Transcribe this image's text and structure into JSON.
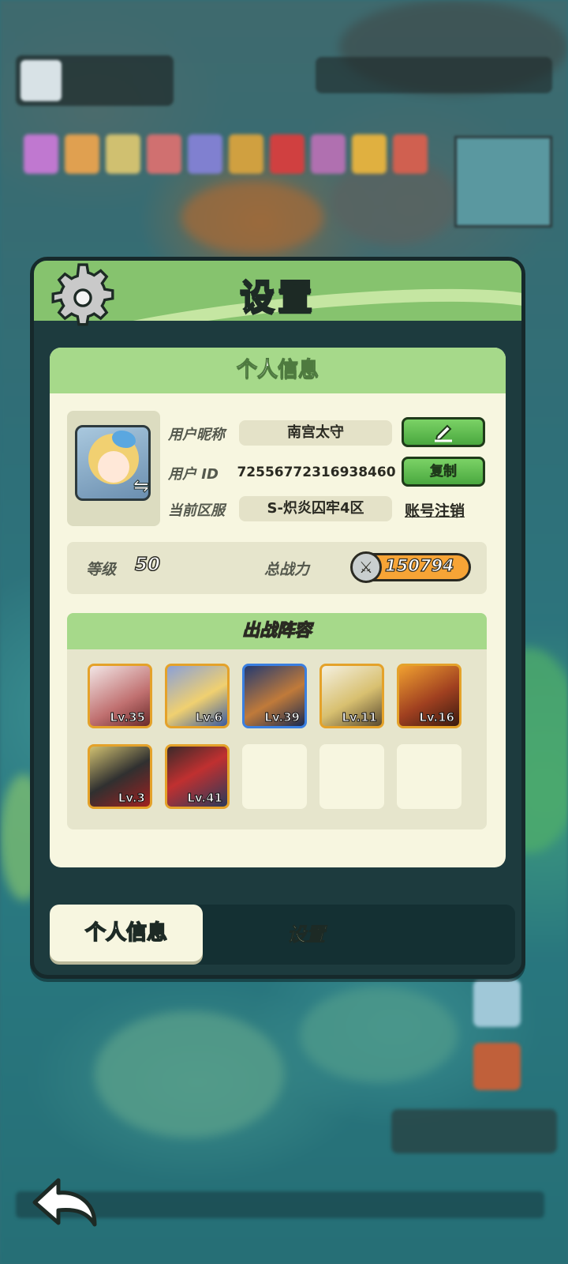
{
  "dialog": {
    "title": "设置"
  },
  "profile_panel": {
    "header": "个人信息",
    "nickname_label": "用户昵称",
    "nickname_value": "南宫太守",
    "edit_icon": "pencil-icon",
    "id_label": "用户 ID",
    "id_value": "72556772316938460",
    "copy_label": "复制",
    "server_label": "当前区服",
    "server_value": "S-炽炎囚牢4区",
    "account_cancel_label": "账号注销"
  },
  "stats": {
    "level_label": "等级",
    "level_value": "50",
    "power_label": "总战力",
    "power_value": "150794"
  },
  "lineup": {
    "header": "出战阵容",
    "heroes": [
      {
        "level": "Lv.35",
        "frame": "gold"
      },
      {
        "level": "Lv.6",
        "frame": "gold"
      },
      {
        "level": "Lv.39",
        "frame": "blue"
      },
      {
        "level": "Lv.11",
        "frame": "gold"
      },
      {
        "level": "Lv.16",
        "frame": "gold"
      },
      {
        "level": "Lv.3",
        "frame": "gold"
      },
      {
        "level": "Lv.41",
        "frame": "gold"
      }
    ],
    "empty_slots": 3
  },
  "tabs": [
    {
      "label": "个人信息",
      "active": true
    },
    {
      "label": "设置",
      "active": false
    }
  ],
  "colors": {
    "header_green": "#86c36e",
    "panel_bg": "#f7f6e0",
    "button_green": "#4aa83f",
    "frame_gold": "#e4a22a",
    "frame_blue": "#3a7fe0"
  }
}
